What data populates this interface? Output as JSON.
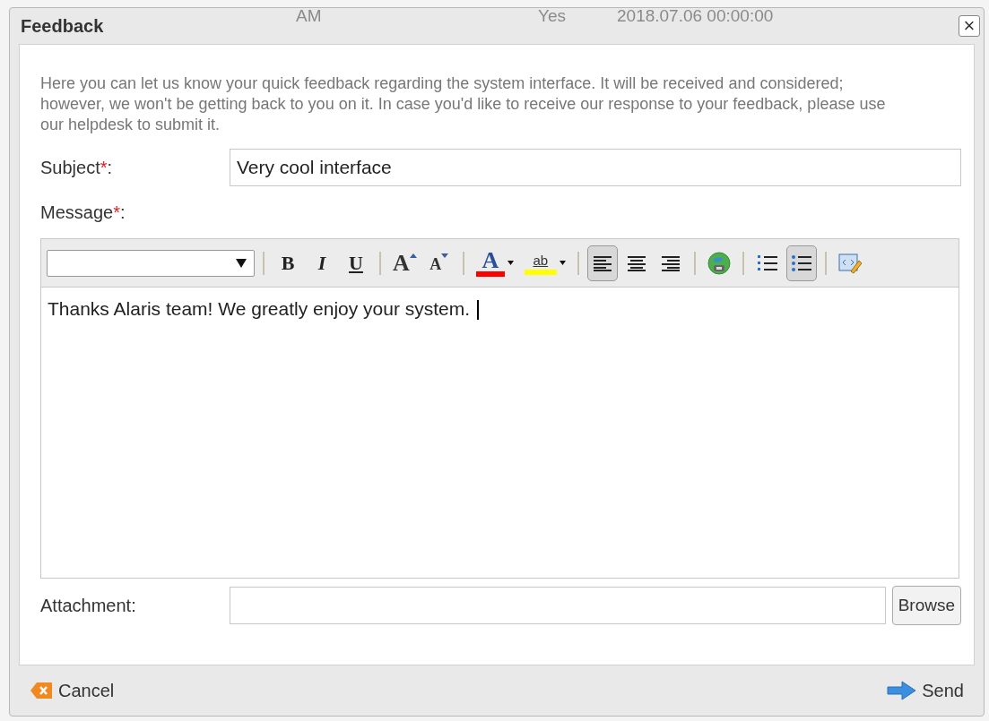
{
  "background_row": [
    "AM",
    "Yes",
    "2018.07.06 00:00:00"
  ],
  "window": {
    "title": "Feedback",
    "close": "×"
  },
  "intro": "Here you can let us know your quick feedback regarding the system interface. It will be received and considered; however, we won't be getting back to you on it. In case you'd like to receive our response to your feedback, please use our helpdesk to submit it.",
  "subject": {
    "label": "Subject",
    "required": true,
    "required_mark": "*",
    "suffix": ":",
    "value": "Very cool interface"
  },
  "message": {
    "label": "Message",
    "required": true,
    "required_mark": "*",
    "suffix": ":",
    "value": "Thanks Alaris team! We greatly enjoy your system."
  },
  "toolbar": [
    {
      "kind": "select"
    },
    {
      "kind": "separator"
    },
    {
      "kind": "bold",
      "label": "B",
      "selected": false
    },
    {
      "kind": "italic",
      "label": "I",
      "selected": false
    },
    {
      "kind": "underline",
      "label": "U",
      "selected": false
    },
    {
      "kind": "separator"
    },
    {
      "kind": "grow",
      "label": "A",
      "selected": false
    },
    {
      "kind": "shrink",
      "label": "A",
      "selected": false
    },
    {
      "kind": "separator"
    },
    {
      "kind": "fontcolor",
      "label": "A",
      "color": "#ff0000",
      "selected": false
    },
    {
      "kind": "highlight",
      "label": "ab",
      "color": "#ffff00",
      "selected": false
    },
    {
      "kind": "separator"
    },
    {
      "kind": "align-left",
      "selected": true
    },
    {
      "kind": "align-center",
      "selected": false
    },
    {
      "kind": "align-right",
      "selected": false
    },
    {
      "kind": "separator"
    },
    {
      "kind": "link",
      "selected": false
    },
    {
      "kind": "separator"
    },
    {
      "kind": "ordered-list",
      "selected": false
    },
    {
      "kind": "bullet-list",
      "selected": true
    },
    {
      "kind": "separator"
    },
    {
      "kind": "source",
      "selected": false
    }
  ],
  "attachment": {
    "label": "Attachment:",
    "button": "Browse"
  },
  "footer": {
    "cancel": "Cancel",
    "send": "Send"
  }
}
